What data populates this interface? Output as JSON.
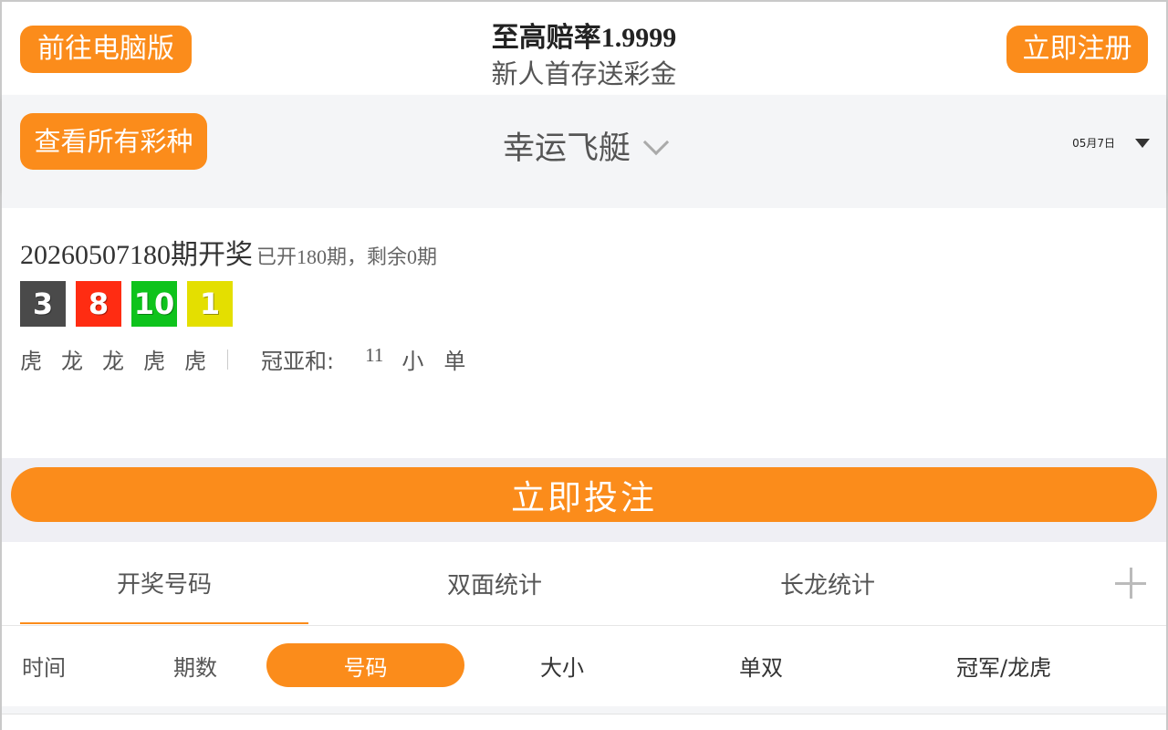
{
  "header": {
    "pc_button": "前往电脑版",
    "promo_title": "至高赔率1.9999",
    "promo_sub": "新人首存送彩金",
    "register_button": "立即注册"
  },
  "lottery_bar": {
    "all_button": "查看所有彩种",
    "lottery_name": "幸运飞艇",
    "date": "05月7日"
  },
  "result": {
    "issue_no": "20260507180",
    "issue_suffix": "期开奖",
    "issue_meta": "已开180期，剩余0期",
    "balls": [
      "3",
      "8",
      "10",
      "1"
    ],
    "dragon_tiger": [
      "虎",
      "龙",
      "龙",
      "虎",
      "虎"
    ],
    "sum_label": "冠亚和:",
    "sum_value": "11",
    "sum_size": "小",
    "sum_oe": "单"
  },
  "bet_button": "立即投注",
  "tabs": [
    {
      "label": "开奖号码",
      "active": true
    },
    {
      "label": "双面统计",
      "active": false
    },
    {
      "label": "长龙统计",
      "active": false
    }
  ],
  "subfilter": {
    "time": "时间",
    "issue": "期数",
    "number": "号码",
    "size": "大小",
    "odd_even": "单双",
    "champion": "冠军/龙虎"
  },
  "colors": {
    "accent": "#fb8c1b",
    "ball_1": "#4a4a4a",
    "ball_2": "#ff2c12",
    "ball_3": "#0ec31c",
    "ball_4": "#e4df00"
  },
  "icons": [
    "chevron-down-icon",
    "caret-down-icon",
    "plus-icon"
  ]
}
